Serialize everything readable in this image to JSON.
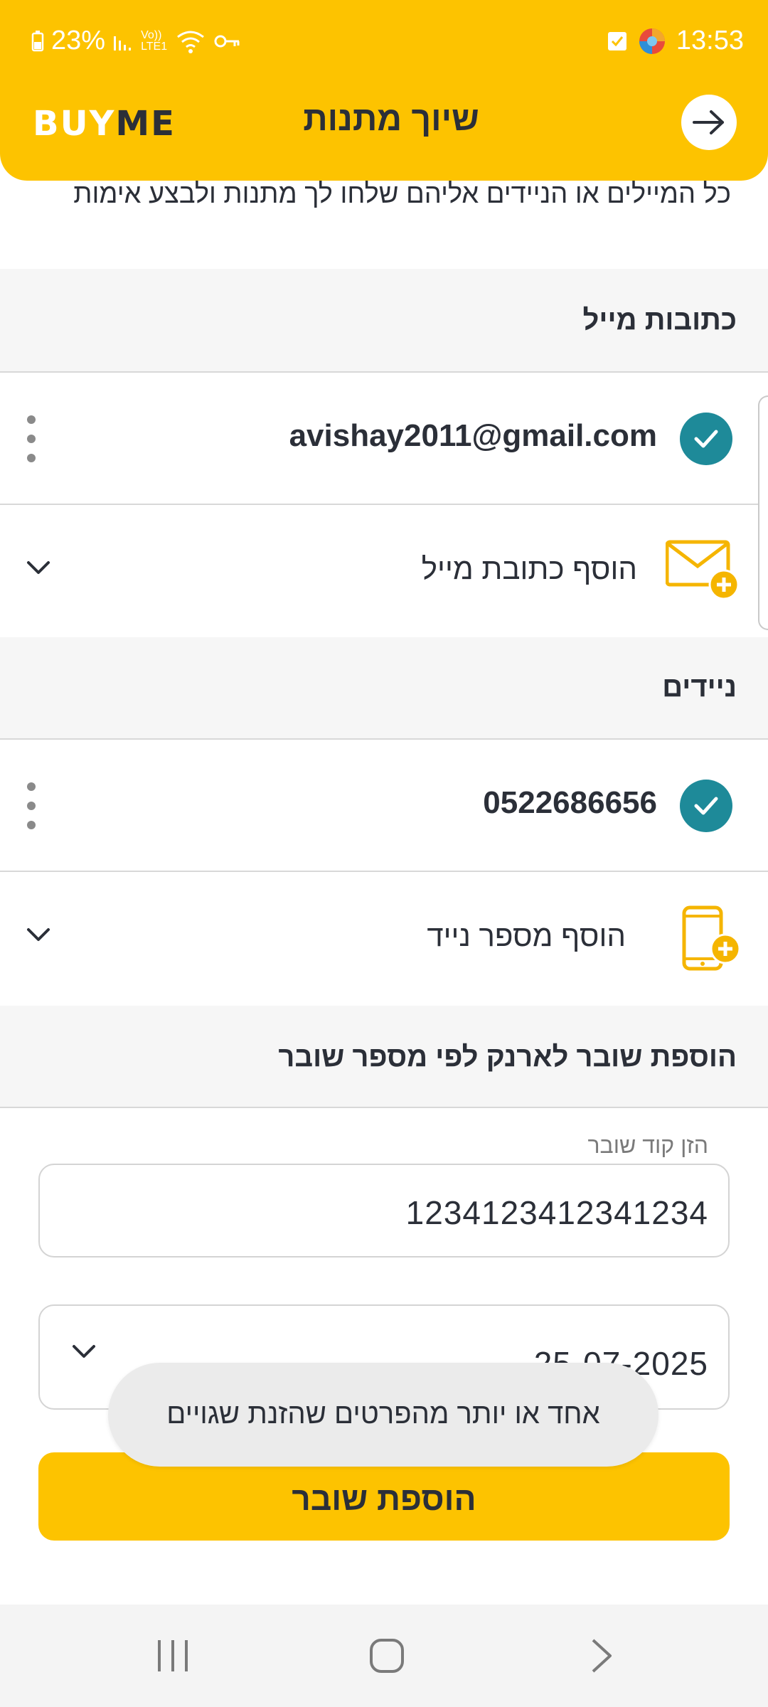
{
  "status_bar": {
    "battery": "23%",
    "network": "Vo)) LTE1",
    "time": "13:53"
  },
  "header": {
    "logo_buy": "BUY",
    "logo_me": "ME",
    "title": "שיוך מתנות"
  },
  "intro_text": "כל המיילים או הניידים אליהם שלחו לך מתנות ולבצע אימות",
  "emails": {
    "heading": "כתובות מייל",
    "verified": "avishay2011@gmail.com",
    "add_label": "הוסף כתובת מייל"
  },
  "phones": {
    "heading": "ניידים",
    "verified": "0522686656",
    "add_label": "הוסף מספר נייד"
  },
  "voucher": {
    "heading": "הוספת שובר לארנק לפי מספר שובר",
    "code_label": "הזן קוד שובר",
    "code_value": "1234123412341234",
    "date_value": "25-07-2025",
    "submit_label": "הוספת שובר"
  },
  "toast": "אחד או יותר מהפרטים שהזנת שגויים",
  "colors": {
    "brand_yellow": "#fdc300",
    "check_teal": "#1e8a99",
    "text_dark": "#2b2f38"
  },
  "icons": [
    "back-arrow-icon",
    "check-icon",
    "kebab-menu-icon",
    "email-add-icon",
    "phone-add-icon",
    "chevron-down-icon"
  ]
}
